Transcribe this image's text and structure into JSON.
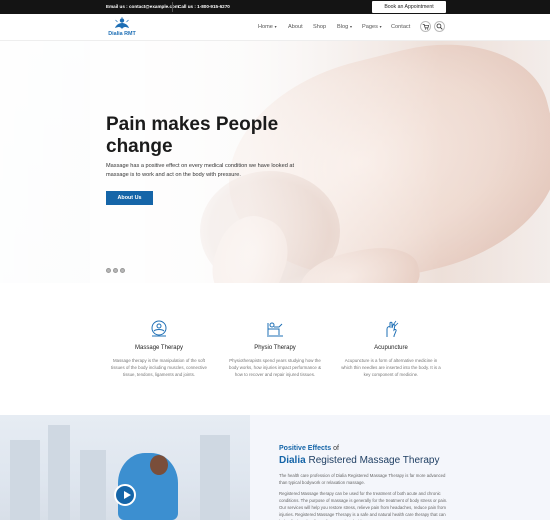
{
  "topbar": {
    "email": "Email us : contact@example.com",
    "phone": "Call us : 1-800-915-6270",
    "appointment": "Book an Appointment"
  },
  "header": {
    "logo_text": "Dialia RMT",
    "nav": [
      "Home",
      "About",
      "Shop",
      "Blog",
      "Pages",
      "Contact"
    ],
    "cart_icon": "cart-icon",
    "search_icon": "search-icon"
  },
  "hero": {
    "title": "Pain makes People change",
    "text": "Massage has a positive effect on every medical condition we have looked at massage is to work and act on the body with pressure.",
    "button": "About Us"
  },
  "services": [
    {
      "icon": "massage-therapy-icon",
      "title": "Massage Therapy",
      "text": "Massage therapy is the manipulation of the soft tissues of the body including muscles, connective tissue, tendons, ligaments and joints."
    },
    {
      "icon": "physio-therapy-icon",
      "title": "Physio Therapy",
      "text": "Physiotherapists spend years studying how the body works, how injuries impact performance & how to recover and repair injured tissues."
    },
    {
      "icon": "acupuncture-icon",
      "title": "Acupuncture",
      "text": "Acupuncture is a form of alternative medicine in which thin needles are inserted into the body. It is a key component of medicine."
    }
  ],
  "positive": {
    "title_blue": "Positive Effects",
    "title_rest": "of",
    "subtitle_bold": "Dialia",
    "subtitle_rest": "Registered Massage Therapy",
    "p1": "The health care profession of Dialia Registered Massage Therapy is far more advanced than typical bodywork or relaxation massage.",
    "p2": "Registered Massage therapy can be used for the treatment of both acute and chronic conditions. The purpose of massage is generally for the treatment of body stress or pain. Our services will help you restore stress, relieve pain from headaches, reduce pain from injuries. Registered Massage Therapy is a safe and natural health care therapy that can help alleviate the discomfort associated with a range..."
  },
  "colors": {
    "accent": "#1565a8",
    "topbar": "#141414"
  }
}
